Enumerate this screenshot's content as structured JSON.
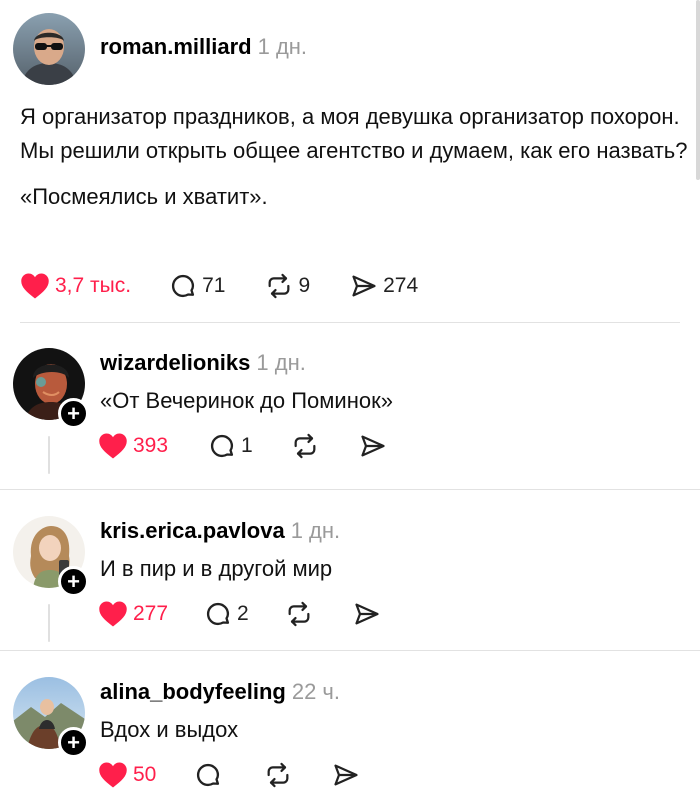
{
  "post": {
    "username": "roman.milliard",
    "time": "1 дн.",
    "paragraphs": [
      "Я организатор праздников, а моя девушка организатор похорон. Мы решили открыть общее агентство и думаем, как его назвать?",
      "«Посмеялись и хватит»."
    ],
    "likes": "3,7 тыс.",
    "comments": "71",
    "reposts": "9",
    "shares": "274"
  },
  "replies": [
    {
      "username": "wizardelioniks",
      "time": "1 дн.",
      "text": "«От Вечеринок до Поминок»",
      "likes": "393",
      "comments": "1"
    },
    {
      "username": "kris.erica.pavlova",
      "time": "1 дн.",
      "text": "И в пир и в другой мир",
      "likes": "277",
      "comments": "2"
    },
    {
      "username": "alina_bodyfeeling",
      "time": "22 ч.",
      "text": "Вдох и выдох",
      "likes": "50",
      "comments": ""
    }
  ],
  "icons": {
    "like": "heart-icon",
    "comment": "comment-bubble-icon",
    "repost": "repost-icon",
    "share": "send-icon",
    "follow": "plus-icon"
  },
  "colors": {
    "like": "#ff1f4b",
    "time": "#9a9a9a",
    "divider": "#e2e2e2"
  }
}
